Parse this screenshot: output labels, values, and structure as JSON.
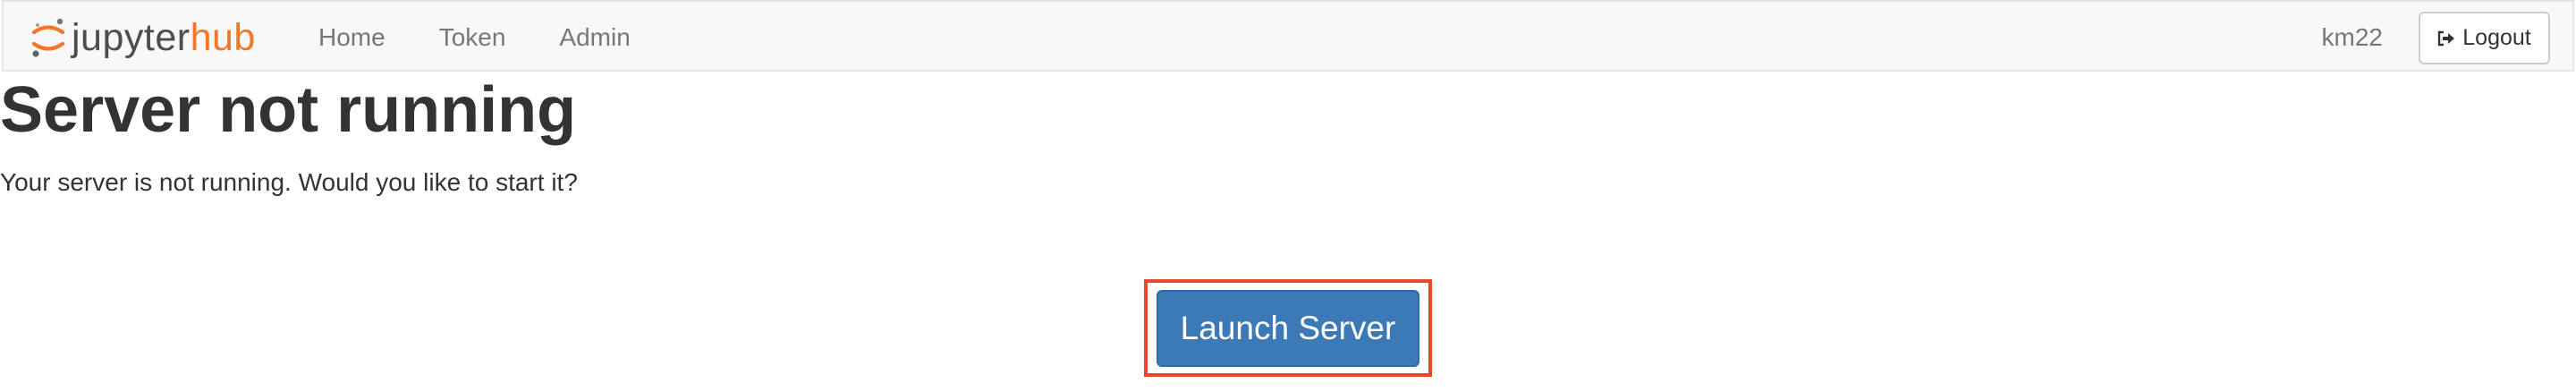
{
  "header": {
    "logo": {
      "text_part1": "jupyter",
      "text_part2": "hub",
      "icon": "jupyter-logo-icon"
    },
    "nav": [
      {
        "label": "Home"
      },
      {
        "label": "Token"
      },
      {
        "label": "Admin"
      }
    ],
    "user": "km22",
    "logout": {
      "label": "Logout",
      "icon": "sign-out-icon"
    }
  },
  "main": {
    "title": "Server not running",
    "message": "Your server is not running. Would you like to start it?",
    "launch_label": "Launch Server"
  },
  "colors": {
    "brand_orange": "#f37726",
    "primary_button": "#3b7ab6",
    "highlight_border": "#e8472a",
    "navbar_bg": "#f8f8f8"
  }
}
